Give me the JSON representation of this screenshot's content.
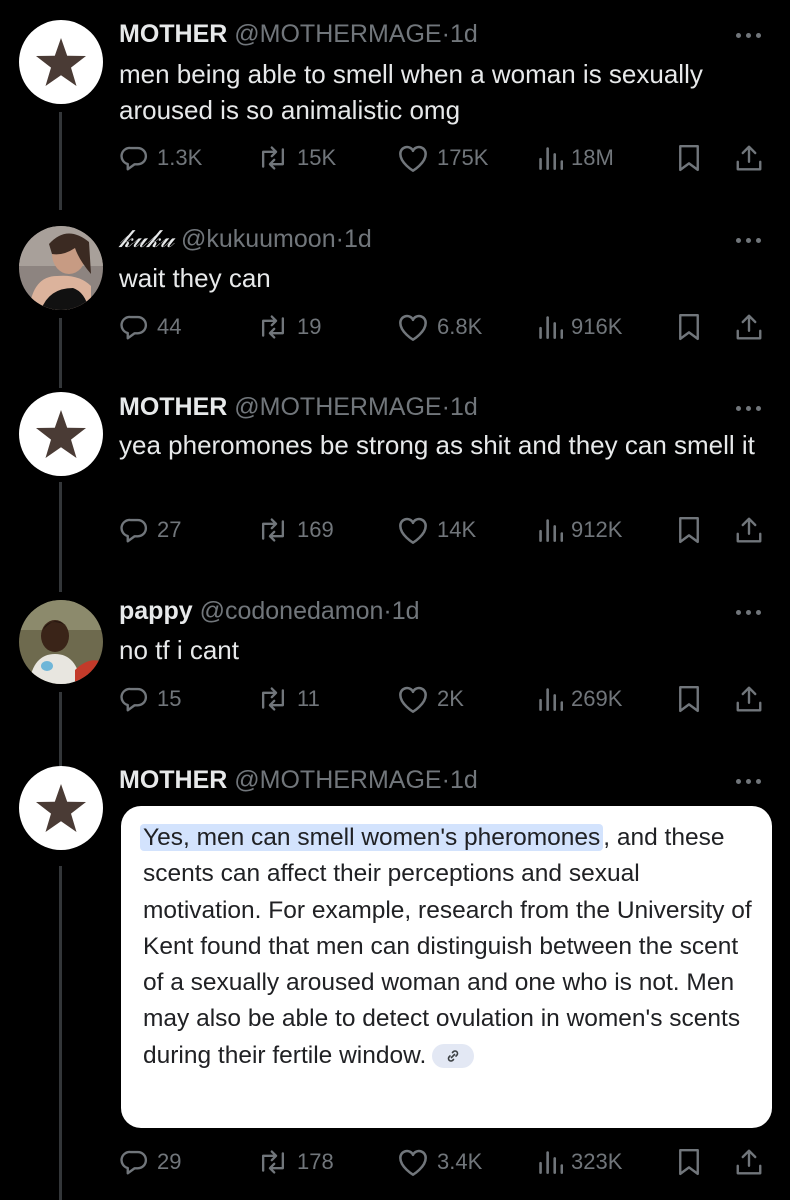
{
  "tweets": [
    {
      "name": "MOTHER",
      "handle": "@MOTHERMAGE",
      "sep": "·",
      "time": "1d",
      "text": "men being able to smell when a woman is sexually aroused is so animalistic omg",
      "replies": "1.3K",
      "retweets": "15K",
      "likes": "175K",
      "views": "18M",
      "avatar": "star-icon"
    },
    {
      "name": "𝓀𝓊𝓀𝓊",
      "handle": "@kukuumoon",
      "sep": "·",
      "time": "1d",
      "text": "wait they can",
      "replies": "44",
      "retweets": "19",
      "likes": "6.8K",
      "views": "916K",
      "avatar": "profile-photo"
    },
    {
      "name": "MOTHER",
      "handle": "@MOTHERMAGE",
      "sep": "·",
      "time": "1d",
      "text": "yea pheromones be strong as shit and they can smell it",
      "replies": "27",
      "retweets": "169",
      "likes": "14K",
      "views": "912K",
      "avatar": "star-icon"
    },
    {
      "name": "pappy",
      "handle": "@codonedamon",
      "sep": "·",
      "time": "1d",
      "text": "no tf i cant",
      "replies": "15",
      "retweets": "11",
      "likes": "2K",
      "views": "269K",
      "avatar": "profile-photo"
    },
    {
      "name": "MOTHER",
      "handle": "@MOTHERMAGE",
      "sep": "·",
      "time": "1d",
      "card": {
        "highlight": "Yes, men can smell women's pheromones",
        "body": ", and these scents can affect their perceptions and sexual motivation. For example, research from the University of Kent found that men can distinguish between the scent of a sexually aroused woman and one who is not. Men may also be able to detect ovulation in women's scents during their fertile window."
      },
      "replies": "29",
      "retweets": "178",
      "likes": "3.4K",
      "views": "323K",
      "avatar": "star-icon"
    }
  ],
  "colors": {
    "background": "#000000",
    "text": "#e7e9ea",
    "muted": "#71767b",
    "highlight": "#d3e3fd"
  }
}
